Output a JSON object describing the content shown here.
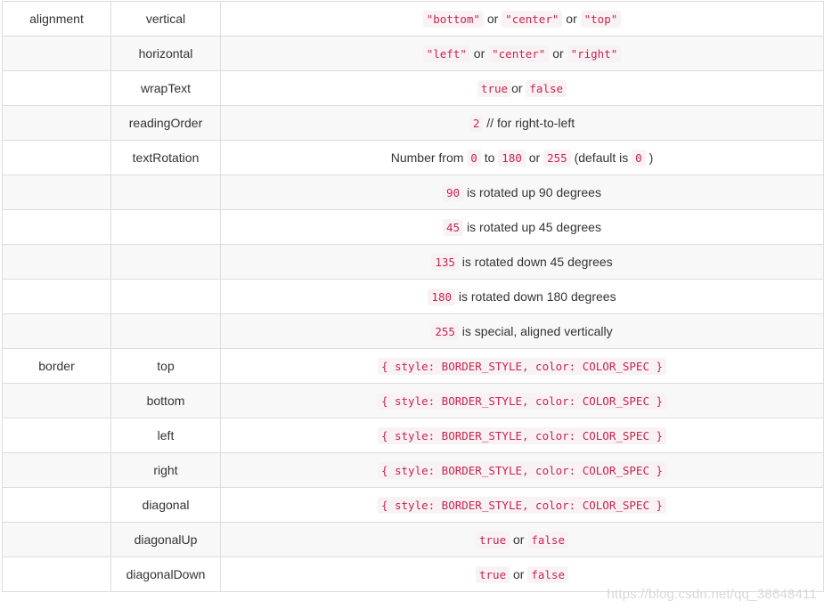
{
  "rows": [
    {
      "group": "alignment",
      "prop": "vertical",
      "desc": [
        {
          "c": "\"bottom\""
        },
        {
          "t": " or "
        },
        {
          "c": "\"center\""
        },
        {
          "t": " or "
        },
        {
          "c": "\"top\""
        }
      ]
    },
    {
      "group": "",
      "prop": "horizontal",
      "desc": [
        {
          "c": "\"left\""
        },
        {
          "t": " or "
        },
        {
          "c": "\"center\""
        },
        {
          "t": " or "
        },
        {
          "c": "\"right\""
        }
      ]
    },
    {
      "group": "",
      "prop": "wrapText",
      "desc": [
        {
          "c": "true"
        },
        {
          "t": "or "
        },
        {
          "c": "false"
        }
      ]
    },
    {
      "group": "",
      "prop": "readingOrder",
      "desc": [
        {
          "c": "2"
        },
        {
          "t": " // for right-to-left"
        }
      ]
    },
    {
      "group": "",
      "prop": "textRotation",
      "desc": [
        {
          "t": "Number from "
        },
        {
          "c": "0"
        },
        {
          "t": " to "
        },
        {
          "c": "180"
        },
        {
          "t": " or "
        },
        {
          "c": "255"
        },
        {
          "t": " (default is "
        },
        {
          "c": "0"
        },
        {
          "t": " )"
        }
      ]
    },
    {
      "group": "",
      "prop": "",
      "desc": [
        {
          "c": "90"
        },
        {
          "t": " is rotated up 90 degrees"
        }
      ]
    },
    {
      "group": "",
      "prop": "",
      "desc": [
        {
          "c": "45"
        },
        {
          "t": " is rotated up 45 degrees"
        }
      ]
    },
    {
      "group": "",
      "prop": "",
      "desc": [
        {
          "c": "135"
        },
        {
          "t": " is rotated down 45 degrees"
        }
      ]
    },
    {
      "group": "",
      "prop": "",
      "desc": [
        {
          "c": "180"
        },
        {
          "t": " is rotated down 180 degrees"
        }
      ]
    },
    {
      "group": "",
      "prop": "",
      "desc": [
        {
          "c": "255"
        },
        {
          "t": " is special, aligned vertically"
        }
      ]
    },
    {
      "group": "border",
      "prop": "top",
      "desc": [
        {
          "c": "{ style: BORDER_STYLE, color: COLOR_SPEC }"
        }
      ]
    },
    {
      "group": "",
      "prop": "bottom",
      "desc": [
        {
          "c": "{ style: BORDER_STYLE, color: COLOR_SPEC }"
        }
      ]
    },
    {
      "group": "",
      "prop": "left",
      "desc": [
        {
          "c": "{ style: BORDER_STYLE, color: COLOR_SPEC }"
        }
      ]
    },
    {
      "group": "",
      "prop": "right",
      "desc": [
        {
          "c": "{ style: BORDER_STYLE, color: COLOR_SPEC }"
        }
      ]
    },
    {
      "group": "",
      "prop": "diagonal",
      "desc": [
        {
          "c": "{ style: BORDER_STYLE, color: COLOR_SPEC }"
        }
      ]
    },
    {
      "group": "",
      "prop": "diagonalUp",
      "desc": [
        {
          "c": "true"
        },
        {
          "t": " or "
        },
        {
          "c": "false"
        }
      ]
    },
    {
      "group": "",
      "prop": "diagonalDown",
      "desc": [
        {
          "c": "true"
        },
        {
          "t": " or "
        },
        {
          "c": "false"
        }
      ]
    }
  ],
  "watermark": "https://blog.csdn.net/qq_38648411",
  "colors": {
    "code_text": "#c7254e",
    "code_bg": "#f9f2f4",
    "row_stripe": "#f8f8f8",
    "border": "#dddddd"
  }
}
